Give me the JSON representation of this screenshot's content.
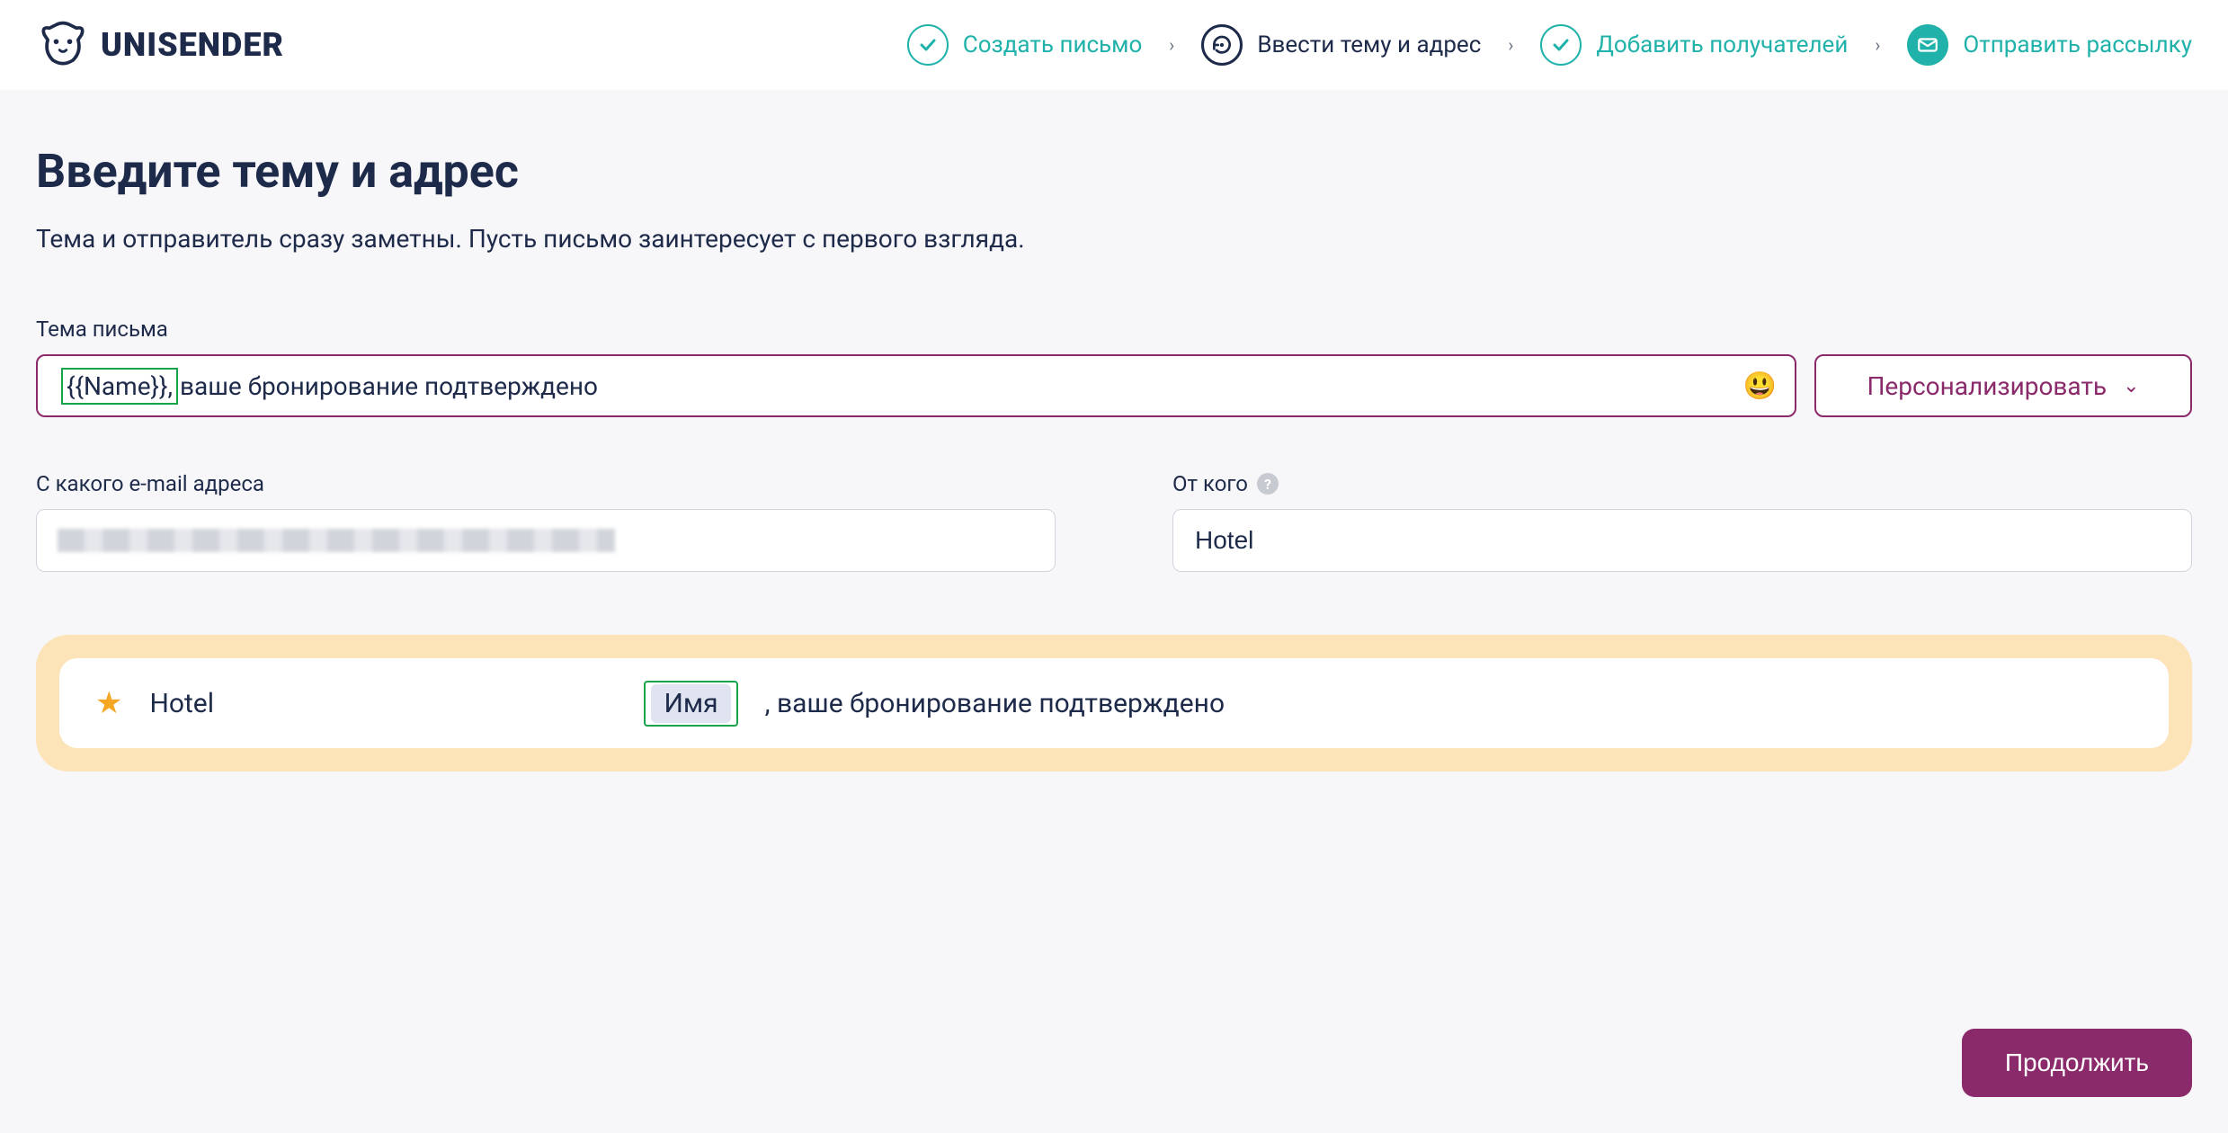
{
  "brand": "UNISENDER",
  "steps": {
    "create": "Создать письмо",
    "subject": "Ввести тему и адрес",
    "recipients": "Добавить получателей",
    "send": "Отправить рассылку"
  },
  "page": {
    "title": "Введите тему и адрес",
    "subtitle": "Тема и отправитель сразу заметны. Пусть письмо заинтересует с первого взгляда."
  },
  "subject": {
    "label": "Тема письма",
    "token": "{{Name}},",
    "rest": "ваше бронирование подтверждено",
    "emoji": "😃",
    "personalize": "Персонализировать"
  },
  "from_email": {
    "label": "С какого e-mail адреса",
    "value": ""
  },
  "from_name": {
    "label": "От кого",
    "value": "Hotel"
  },
  "preview": {
    "from": "Hotel",
    "token_label": "Имя",
    "rest": ", ваше бронирование подтверждено"
  },
  "continue_label": "Продолжить"
}
